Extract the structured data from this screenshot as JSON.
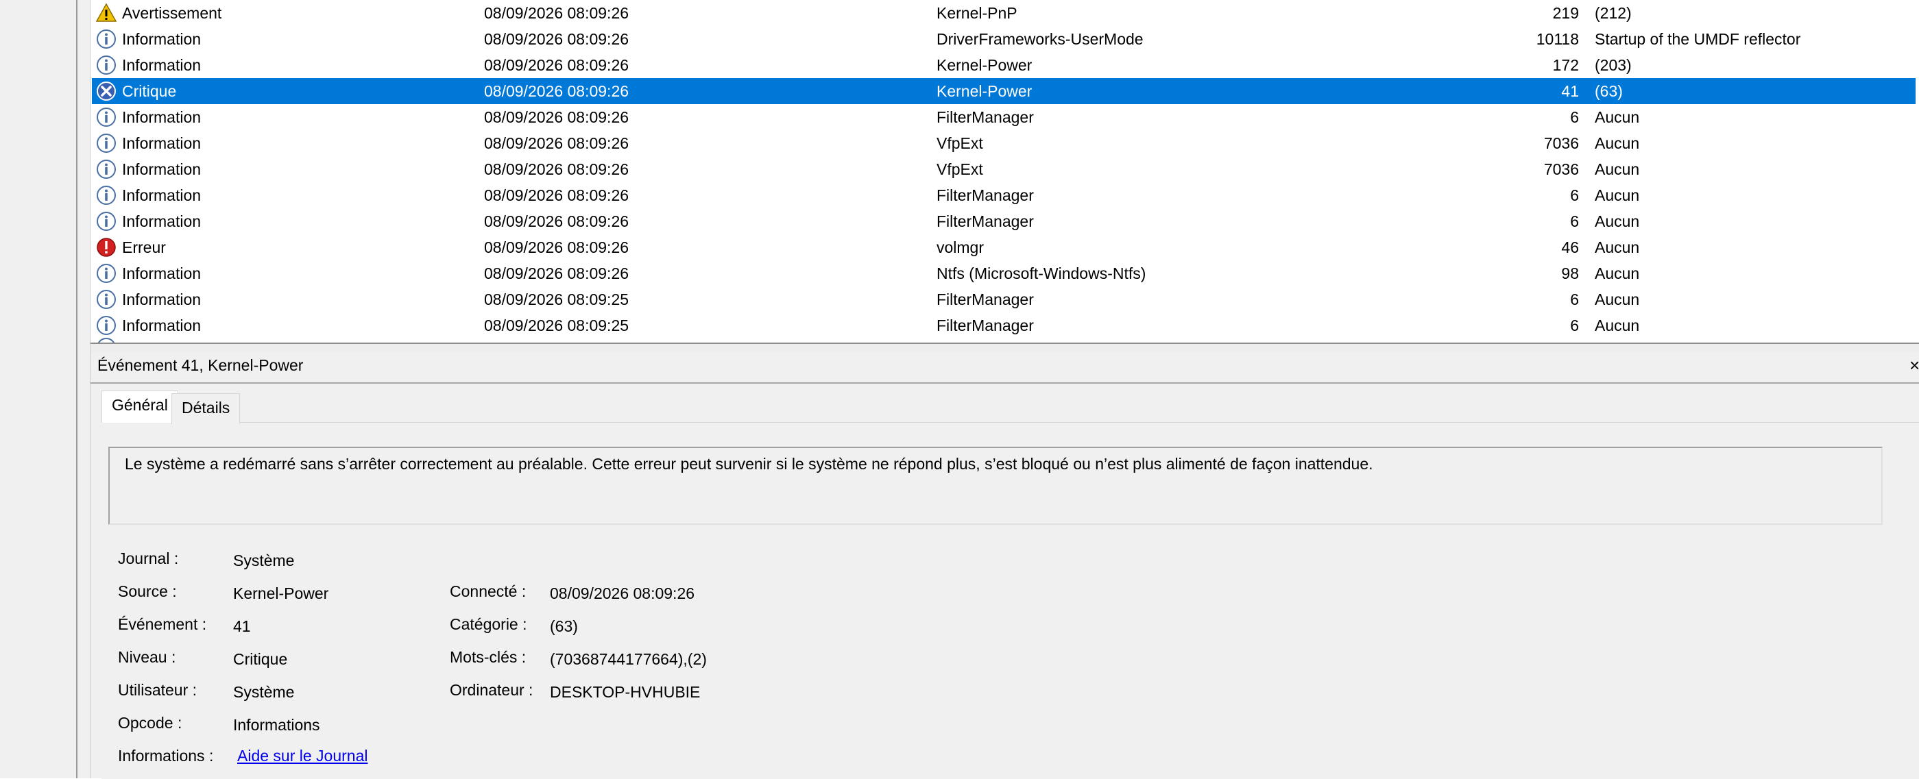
{
  "events": [
    {
      "level": "Avertissement",
      "icon": "warning-icon",
      "datetime": "08/09/2026 08:09:26",
      "source": "Kernel-PnP",
      "id": "219",
      "task": "(212)",
      "selected": false
    },
    {
      "level": "Information",
      "icon": "info-icon",
      "datetime": "08/09/2026 08:09:26",
      "source": "DriverFrameworks-UserMode",
      "id": "10118",
      "task": "Startup of the UMDF reflector",
      "selected": false
    },
    {
      "level": "Information",
      "icon": "info-icon",
      "datetime": "08/09/2026 08:09:26",
      "source": "Kernel-Power",
      "id": "172",
      "task": "(203)",
      "selected": false
    },
    {
      "level": "Critique",
      "icon": "critical-icon",
      "datetime": "08/09/2026 08:09:26",
      "source": "Kernel-Power",
      "id": "41",
      "task": "(63)",
      "selected": true
    },
    {
      "level": "Information",
      "icon": "info-icon",
      "datetime": "08/09/2026 08:09:26",
      "source": "FilterManager",
      "id": "6",
      "task": "Aucun",
      "selected": false
    },
    {
      "level": "Information",
      "icon": "info-icon",
      "datetime": "08/09/2026 08:09:26",
      "source": "VfpExt",
      "id": "7036",
      "task": "Aucun",
      "selected": false
    },
    {
      "level": "Information",
      "icon": "info-icon",
      "datetime": "08/09/2026 08:09:26",
      "source": "VfpExt",
      "id": "7036",
      "task": "Aucun",
      "selected": false
    },
    {
      "level": "Information",
      "icon": "info-icon",
      "datetime": "08/09/2026 08:09:26",
      "source": "FilterManager",
      "id": "6",
      "task": "Aucun",
      "selected": false
    },
    {
      "level": "Information",
      "icon": "info-icon",
      "datetime": "08/09/2026 08:09:26",
      "source": "FilterManager",
      "id": "6",
      "task": "Aucun",
      "selected": false
    },
    {
      "level": "Erreur",
      "icon": "error-icon",
      "datetime": "08/09/2026 08:09:26",
      "source": "volmgr",
      "id": "46",
      "task": "Aucun",
      "selected": false
    },
    {
      "level": "Information",
      "icon": "info-icon",
      "datetime": "08/09/2026 08:09:26",
      "source": "Ntfs (Microsoft-Windows-Ntfs)",
      "id": "98",
      "task": "Aucun",
      "selected": false
    },
    {
      "level": "Information",
      "icon": "info-icon",
      "datetime": "08/09/2026 08:09:25",
      "source": "FilterManager",
      "id": "6",
      "task": "Aucun",
      "selected": false
    },
    {
      "level": "Information",
      "icon": "info-icon",
      "datetime": "08/09/2026 08:09:25",
      "source": "FilterManager",
      "id": "6",
      "task": "Aucun",
      "selected": false
    }
  ],
  "detail": {
    "title": "Événement 41, Kernel-Power",
    "close_glyph": "×",
    "tabs": {
      "general": "Général",
      "details": "Détails"
    },
    "message": "Le système a redémarré sans s’arrêter correctement au préalable. Cette erreur peut survenir si le système ne répond plus, s’est bloqué ou n’est plus alimenté de façon inattendue.",
    "fields": {
      "journal_label": "Journal :",
      "journal_value": "Système",
      "source_label": "Source :",
      "source_value": "Kernel-Power",
      "event_label": "Événement :",
      "event_value": "41",
      "level_label": "Niveau :",
      "level_value": "Critique",
      "user_label": "Utilisateur :",
      "user_value": "Système",
      "opcode_label": "Opcode :",
      "opcode_value": "Informations",
      "info_label": "Informations :",
      "info_link": "Aide sur le Journal",
      "logged_label": "Connecté :",
      "logged_value": "08/09/2026 08:09:26",
      "category_label": "Catégorie :",
      "category_value": "(63)",
      "keywords_label": "Mots-clés :",
      "keywords_value": "(70368744177664),(2)",
      "computer_label": "Ordinateur :",
      "computer_value": "DESKTOP-HVHUBIE"
    }
  },
  "colors": {
    "selection": "#0078d7",
    "warning": "#f2c200",
    "info": "#4a6fa5",
    "error": "#d21f1f",
    "link": "#0000ee"
  }
}
